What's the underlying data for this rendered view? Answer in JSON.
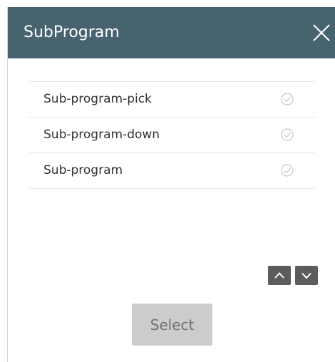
{
  "dialog": {
    "title": "SubProgram",
    "close_icon": "close-icon"
  },
  "list": {
    "items": [
      {
        "label": "Sub-program-pick",
        "icon": "check-circle-icon"
      },
      {
        "label": "Sub-program-down",
        "icon": "check-circle-icon"
      },
      {
        "label": "Sub-program",
        "icon": "check-circle-icon"
      }
    ]
  },
  "controls": {
    "up_icon": "chevron-up-icon",
    "down_icon": "chevron-down-icon",
    "select_label": "Select"
  },
  "colors": {
    "titlebar": "#476370",
    "arrow_buttons": "#5c5c5c",
    "select_button": "#cccccc"
  }
}
